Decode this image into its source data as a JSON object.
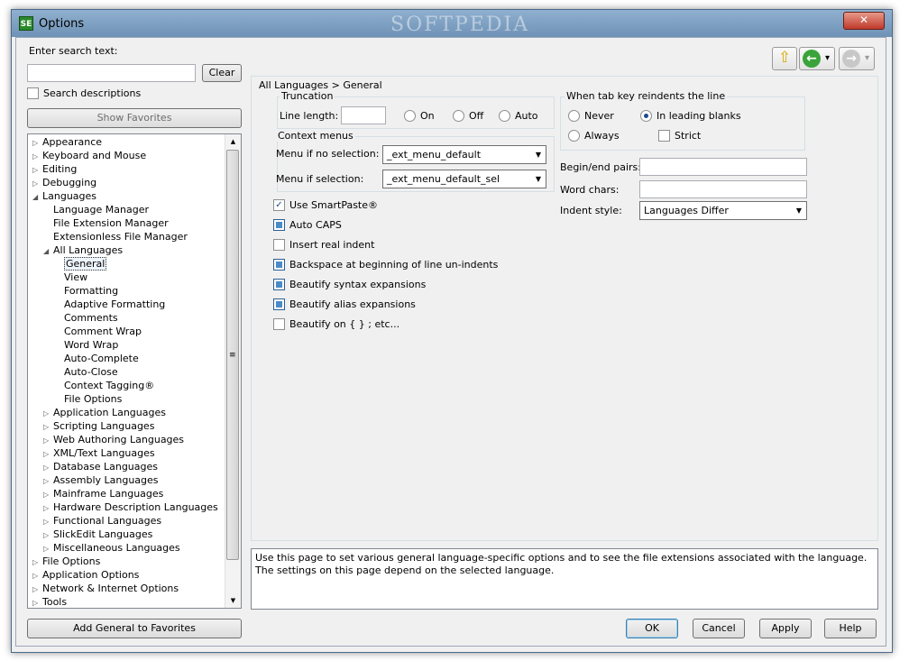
{
  "window": {
    "title": "Options",
    "app_icon": "SE",
    "watermark": "SOFTPEDIA",
    "close_glyph": "✕"
  },
  "left": {
    "search_label": "Enter search text:",
    "search_value": "",
    "clear_label": "Clear",
    "search_descriptions_label": "Search descriptions",
    "search_descriptions_checked": false,
    "show_favorites_label": "Show Favorites",
    "add_favorites_label": "Add General to Favorites"
  },
  "tree": [
    {
      "label": "Appearance",
      "level": 0,
      "toggle": "▷"
    },
    {
      "label": "Keyboard and Mouse",
      "level": 0,
      "toggle": "▷"
    },
    {
      "label": "Editing",
      "level": 0,
      "toggle": "▷"
    },
    {
      "label": "Debugging",
      "level": 0,
      "toggle": "▷"
    },
    {
      "label": "Languages",
      "level": 0,
      "toggle": "◢"
    },
    {
      "label": "Language Manager",
      "level": 1,
      "toggle": ""
    },
    {
      "label": "File Extension Manager",
      "level": 1,
      "toggle": ""
    },
    {
      "label": "Extensionless File Manager",
      "level": 1,
      "toggle": ""
    },
    {
      "label": "All Languages",
      "level": 1,
      "toggle": "◢"
    },
    {
      "label": "General",
      "level": 2,
      "toggle": "",
      "selected": true
    },
    {
      "label": "View",
      "level": 2,
      "toggle": ""
    },
    {
      "label": "Formatting",
      "level": 2,
      "toggle": ""
    },
    {
      "label": "Adaptive Formatting",
      "level": 2,
      "toggle": ""
    },
    {
      "label": "Comments",
      "level": 2,
      "toggle": ""
    },
    {
      "label": "Comment Wrap",
      "level": 2,
      "toggle": ""
    },
    {
      "label": "Word Wrap",
      "level": 2,
      "toggle": ""
    },
    {
      "label": "Auto-Complete",
      "level": 2,
      "toggle": ""
    },
    {
      "label": "Auto-Close",
      "level": 2,
      "toggle": ""
    },
    {
      "label": "Context Tagging®",
      "level": 2,
      "toggle": ""
    },
    {
      "label": "File Options",
      "level": 2,
      "toggle": ""
    },
    {
      "label": "Application Languages",
      "level": 1,
      "toggle": "▷"
    },
    {
      "label": "Scripting Languages",
      "level": 1,
      "toggle": "▷"
    },
    {
      "label": "Web Authoring Languages",
      "level": 1,
      "toggle": "▷"
    },
    {
      "label": "XML/Text Languages",
      "level": 1,
      "toggle": "▷"
    },
    {
      "label": "Database Languages",
      "level": 1,
      "toggle": "▷"
    },
    {
      "label": "Assembly Languages",
      "level": 1,
      "toggle": "▷"
    },
    {
      "label": "Mainframe Languages",
      "level": 1,
      "toggle": "▷"
    },
    {
      "label": "Hardware Description Languages",
      "level": 1,
      "toggle": "▷"
    },
    {
      "label": "Functional Languages",
      "level": 1,
      "toggle": "▷"
    },
    {
      "label": "SlickEdit Languages",
      "level": 1,
      "toggle": "▷"
    },
    {
      "label": "Miscellaneous Languages",
      "level": 1,
      "toggle": "▷"
    },
    {
      "label": "File Options",
      "level": 0,
      "toggle": "▷"
    },
    {
      "label": "Application Options",
      "level": 0,
      "toggle": "▷"
    },
    {
      "label": "Network & Internet Options",
      "level": 0,
      "toggle": "▷"
    },
    {
      "label": "Tools",
      "level": 0,
      "toggle": "▷"
    }
  ],
  "scroll": {
    "up": "▲",
    "down": "▼",
    "grip": "≡"
  },
  "nav": {
    "up_arrow": "⇧",
    "back_arrow": "←",
    "forward_arrow": "→",
    "dropdown": "▾"
  },
  "breadcrumb": "All Languages > General",
  "truncation": {
    "legend": "Truncation",
    "line_length_label": "Line length:",
    "line_length_value": "",
    "options": [
      "On",
      "Off",
      "Auto"
    ],
    "selected": null
  },
  "context_menus": {
    "legend": "Context menus",
    "no_selection_label": "Menu if no selection:",
    "no_selection_value": "_ext_menu_default",
    "selection_label": "Menu if selection:",
    "selection_value": "_ext_menu_default_sel"
  },
  "checkboxes": [
    {
      "label": "Use SmartPaste®",
      "state": "checked"
    },
    {
      "label": "Auto CAPS",
      "state": "indeterminate"
    },
    {
      "label": "Insert real indent",
      "state": "unchecked"
    },
    {
      "label": "Backspace at beginning of line un-indents",
      "state": "indeterminate"
    },
    {
      "label": "Beautify syntax expansions",
      "state": "indeterminate"
    },
    {
      "label": "Beautify alias expansions",
      "state": "indeterminate"
    },
    {
      "label": "Beautify on { } ; etc...",
      "state": "unchecked"
    }
  ],
  "tab_reindent": {
    "legend": "When tab key reindents the line",
    "never_label": "Never",
    "in_leading_blanks_label": "In leading blanks",
    "always_label": "Always",
    "strict_label": "Strict",
    "selected": "In leading blanks",
    "strict_checked": false
  },
  "right_fields": {
    "begin_end_label": "Begin/end pairs:",
    "begin_end_value": "",
    "word_chars_label": "Word chars:",
    "word_chars_value": "",
    "indent_style_label": "Indent style:",
    "indent_style_value": "Languages Differ"
  },
  "description": "Use this page to set various general language-specific options and to see the file extensions associated with the language. The settings on this page depend on the selected language.",
  "buttons": {
    "ok": "OK",
    "cancel": "Cancel",
    "apply": "Apply",
    "help": "Help"
  },
  "colors": {
    "titlebar": "#7c9ec2",
    "selection": "#eef5fc",
    "checkbox_fill": "#4a8bc8"
  }
}
